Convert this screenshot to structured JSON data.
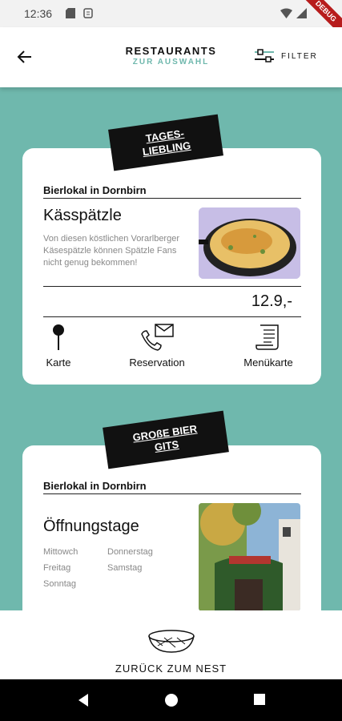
{
  "status_bar": {
    "time": "12:36",
    "debug": "DEBUG"
  },
  "app_bar": {
    "title": "RESTAURANTS",
    "subtitle": "ZUR AUSWAHL",
    "filter_label": "FILTER"
  },
  "cards": [
    {
      "tag": "TAGES-\nLIEBLING",
      "location": "Bierlokal in Dornbirn",
      "dish": "Kässpätzle",
      "description": "Von diesen köstlichen Vorarlberger Käsespätzle können Spätzle Fans nicht genug bekommen!",
      "price": "12.9,-",
      "actions": [
        "Karte",
        "Reservation",
        "Menükarte"
      ]
    },
    {
      "tag": "GROßE BIER\nGITS",
      "location": "Bierlokal in Dornbirn",
      "heading": "Öffnungstage",
      "days_left": [
        "Mittowch",
        "Freitag",
        "Sonntag"
      ],
      "days_right": [
        "Donnerstag",
        "Samstag"
      ]
    }
  ],
  "bottom_bar": {
    "label": "ZURÜCK ZUM NEST"
  },
  "colors": {
    "accent": "#6fb8ad",
    "tag_bg": "#111111"
  }
}
